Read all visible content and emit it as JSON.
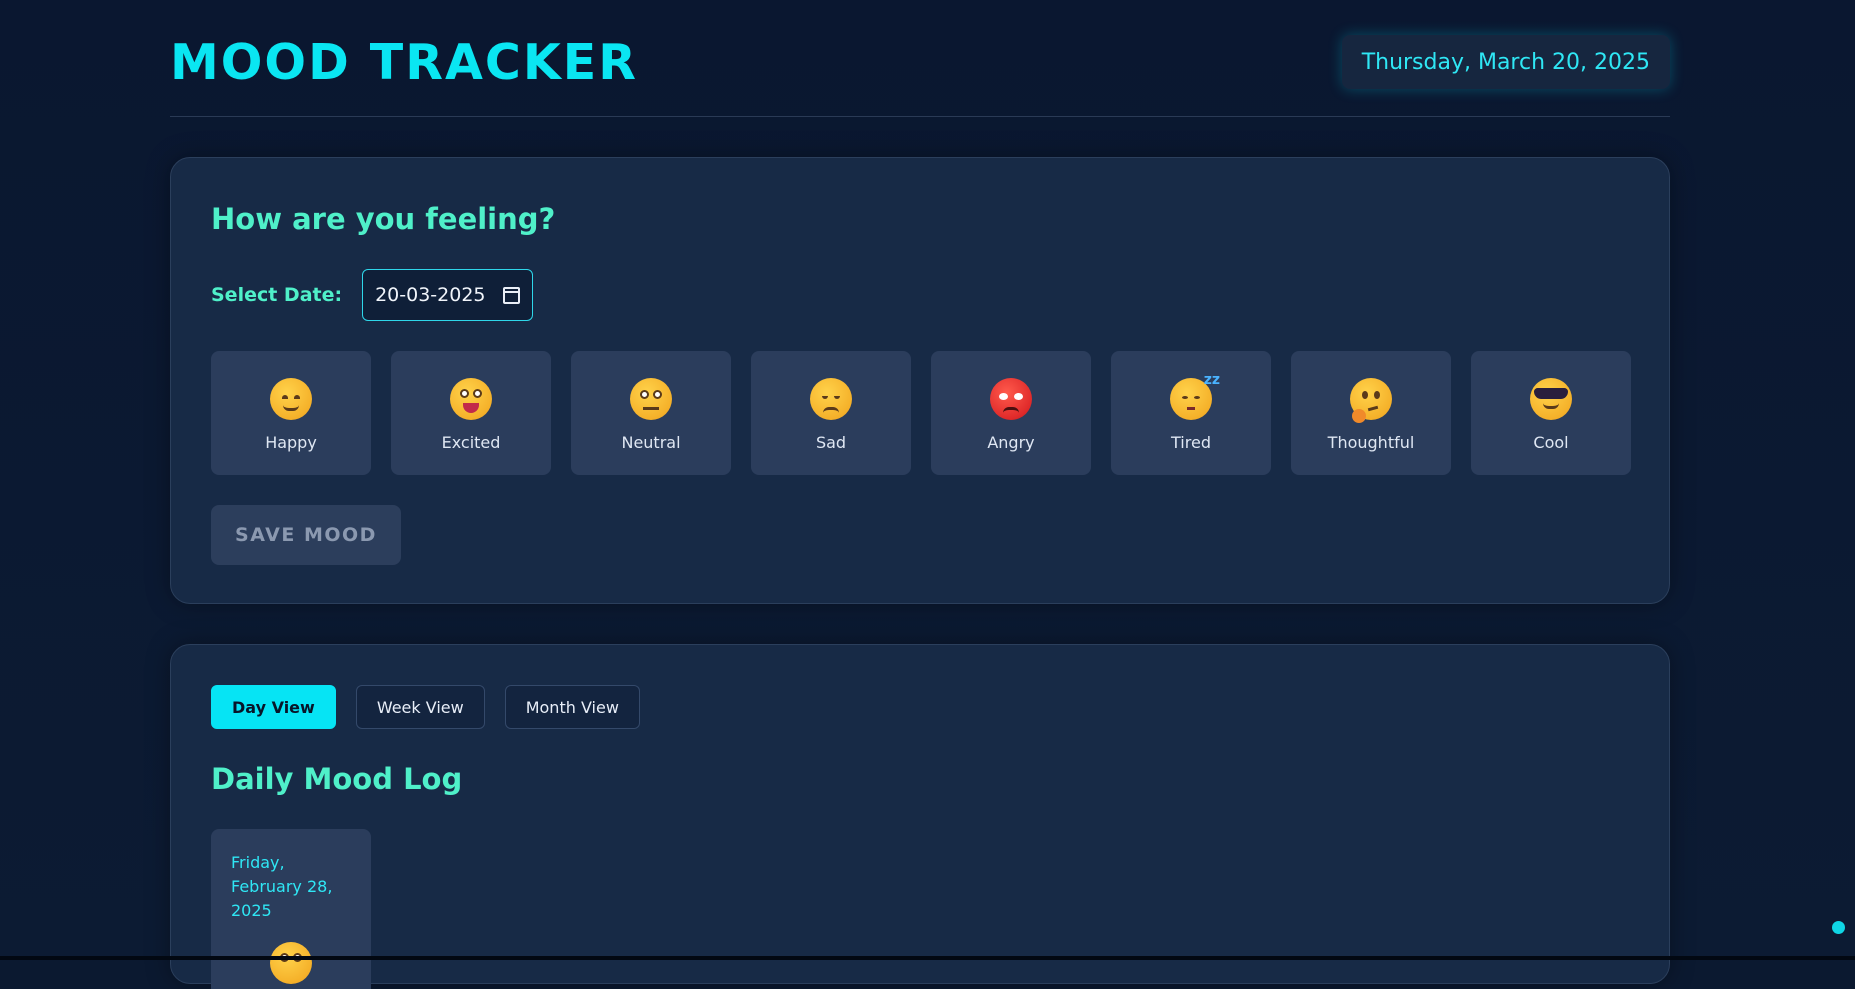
{
  "header": {
    "title": "MOOD TRACKER",
    "current_date": "Thursday, March 20, 2025"
  },
  "mood_form": {
    "heading": "How are you feeling?",
    "date_label": "Select Date:",
    "date_value": "20-03-2025",
    "moods": [
      {
        "label": "Happy",
        "icon": "smiling-face-icon"
      },
      {
        "label": "Excited",
        "icon": "grinning-face-icon"
      },
      {
        "label": "Neutral",
        "icon": "neutral-face-icon"
      },
      {
        "label": "Sad",
        "icon": "pensive-face-icon"
      },
      {
        "label": "Angry",
        "icon": "angry-face-icon"
      },
      {
        "label": "Tired",
        "icon": "sleeping-face-icon"
      },
      {
        "label": "Thoughtful",
        "icon": "thinking-face-icon"
      },
      {
        "label": "Cool",
        "icon": "sunglasses-face-icon"
      }
    ],
    "save_label": "SAVE MOOD"
  },
  "log": {
    "tabs": [
      {
        "label": "Day View",
        "active": true
      },
      {
        "label": "Week View",
        "active": false
      },
      {
        "label": "Month View",
        "active": false
      }
    ],
    "heading": "Daily Mood Log",
    "entries": [
      {
        "date": "Friday, February 28, 2025",
        "icon": "grinning-face-icon"
      }
    ]
  },
  "colors": {
    "accent": "#0ae6f2",
    "heading": "#4ff0c9",
    "background": "#0b1930",
    "card": "#172a46",
    "tile": "#2b3d5c"
  }
}
